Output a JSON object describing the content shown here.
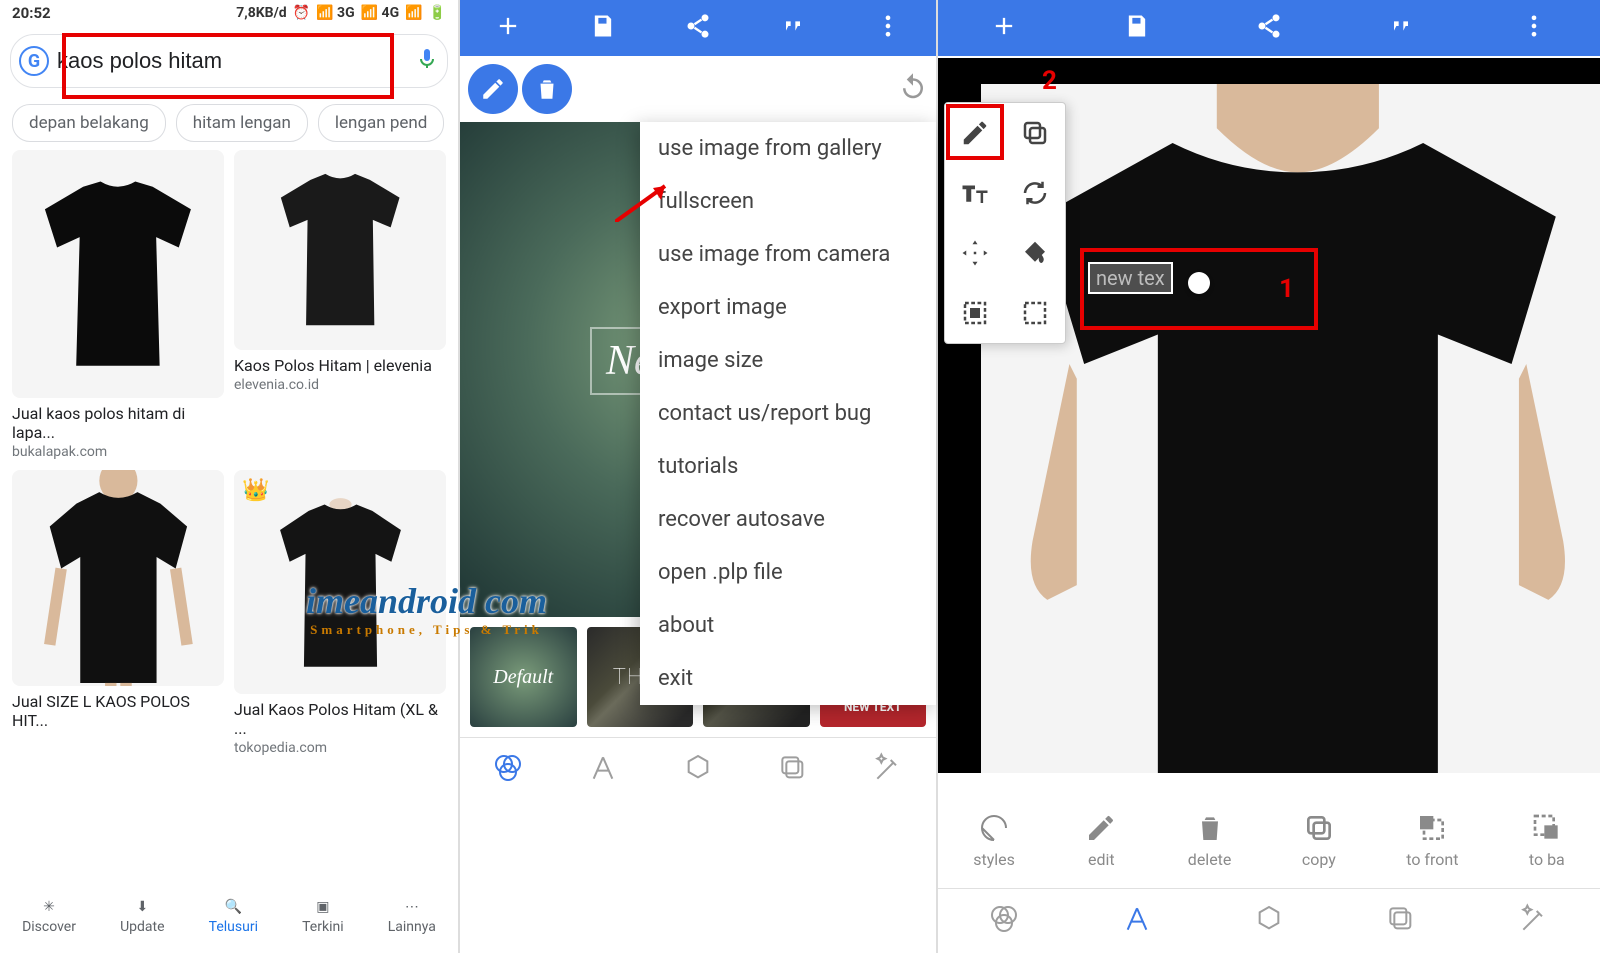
{
  "panel1": {
    "status": {
      "time": "20:52",
      "rate": "7,8KB/d",
      "net1": "3G",
      "net2": "4G"
    },
    "search_query": "kaos polos hitam",
    "chips": [
      "depan belakang",
      "hitam lengan",
      "lengan pend"
    ],
    "results": [
      {
        "title": "Jual kaos polos hitam di lapa...",
        "src": "bukalapak.com"
      },
      {
        "title": "Kaos Polos Hitam | elevenia",
        "src": "elevenia.co.id"
      },
      {
        "title": "Jual SIZE L KAOS POLOS HIT...",
        "src": ""
      },
      {
        "title": "Jual Kaos Polos Hitam (XL & ...",
        "src": "tokopedia.com"
      }
    ],
    "nav": [
      {
        "label": "Discover"
      },
      {
        "label": "Update"
      },
      {
        "label": "Telusuri"
      },
      {
        "label": "Terkini"
      },
      {
        "label": "Lainnya"
      }
    ]
  },
  "panel2": {
    "menu": [
      "use image from gallery",
      "fullscreen",
      "use image from camera",
      "export image",
      "image size",
      "contact us/report bug",
      "tutorials",
      "recover autosave",
      "open .plp file",
      "about",
      "exit"
    ],
    "canvas_text": "Ne",
    "presets": {
      "default": "Default",
      "thin": "THIN",
      "keep": "KEEP\nCALM\nAND\nNEW TEXT"
    }
  },
  "panel3": {
    "sel_text": "new tex",
    "annotations": {
      "n1": "1",
      "n2": "2"
    },
    "actions": [
      "styles",
      "edit",
      "delete",
      "copy",
      "to front",
      "to ba"
    ]
  },
  "watermark": {
    "main": "imeandroid com",
    "sub": "Smartphone, Tips & Trik"
  }
}
